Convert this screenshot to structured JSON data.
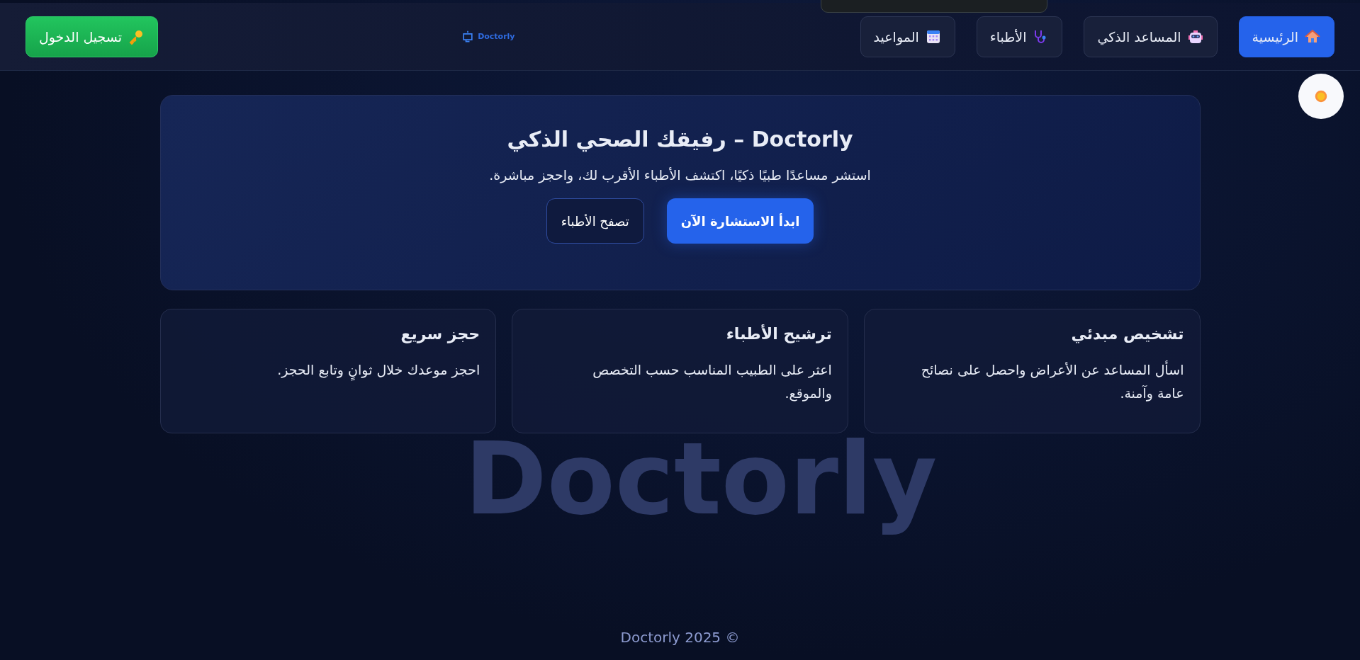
{
  "header": {
    "nav": [
      {
        "label": "الرئيسية",
        "kind": "home",
        "selected": true
      },
      {
        "label": "المساعد الذكي",
        "kind": "assistant",
        "selected": false
      },
      {
        "label": "الأطباء",
        "kind": "doctors",
        "selected": false
      },
      {
        "label": "المواعيد",
        "kind": "appointments",
        "selected": false
      }
    ],
    "logo": "Doctorly",
    "login": "تسجيل الدخول"
  },
  "background_wordmark": "Doctorly",
  "hero": {
    "title": "Doctorly – رفيقك الصحي الذكي",
    "subtitle": "استشر مساعدًا طبيًا ذكيًا، اكتشف الأطباء الأقرب لك، واحجز مباشرة.",
    "buttons": [
      {
        "label": "ابدأ الاستشارة الآن",
        "kind": "primary"
      },
      {
        "label": "تصفح الأطباء",
        "kind": "outline"
      }
    ]
  },
  "features": [
    {
      "title": "تشخيص مبدئي",
      "text": "اسأل المساعد عن الأعراض واحصل على نصائح عامة وآمنة."
    },
    {
      "title": "ترشيح الأطباء",
      "text": "اعثر على الطبيب المناسب حسب التخصص والموقع."
    },
    {
      "title": "حجز سريع",
      "text": "احجز موعدك خلال ثوانٍ وتابع الحجز."
    }
  ],
  "footer": "© Doctorly 2025"
}
